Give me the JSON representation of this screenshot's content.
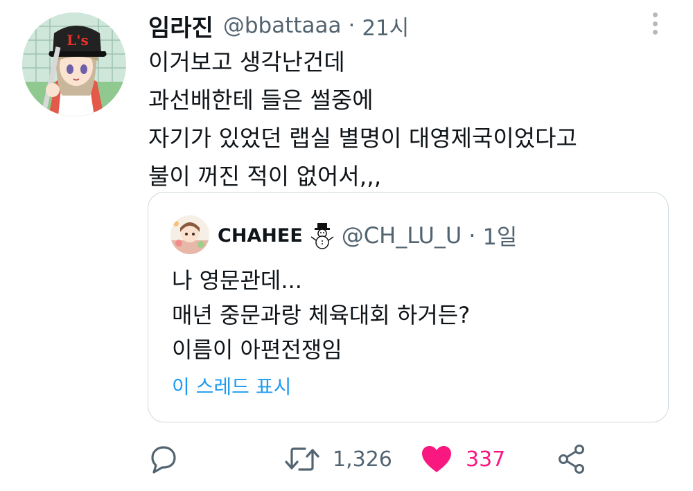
{
  "tweet": {
    "author_name": "임라진",
    "handle": "@bbattaaa",
    "separator": "·",
    "time": "21시",
    "lines": [
      "이거보고 생각난건데",
      "과선배한테 들은 썰중에",
      "자기가 있었던 랩실 별명이 대영제국이었다고",
      "불이 꺼진 적이 없어서,,,"
    ]
  },
  "quoted": {
    "author_name": "CHAHEE",
    "handle": "@CH_LU_U",
    "separator": "·",
    "time": "1일",
    "lines": [
      "나 영문관데...",
      "매년 중문과랑 체육대회 하거든?",
      "이름이 아편전쟁임"
    ],
    "show_thread": "이 스레드 표시"
  },
  "actions": {
    "retweet_count": "1,326",
    "like_count": "337"
  },
  "colors": {
    "text": "#0f1419",
    "secondary": "#536471",
    "link": "#1d9bf0",
    "like": "#f91880",
    "border": "#cfd9de"
  }
}
